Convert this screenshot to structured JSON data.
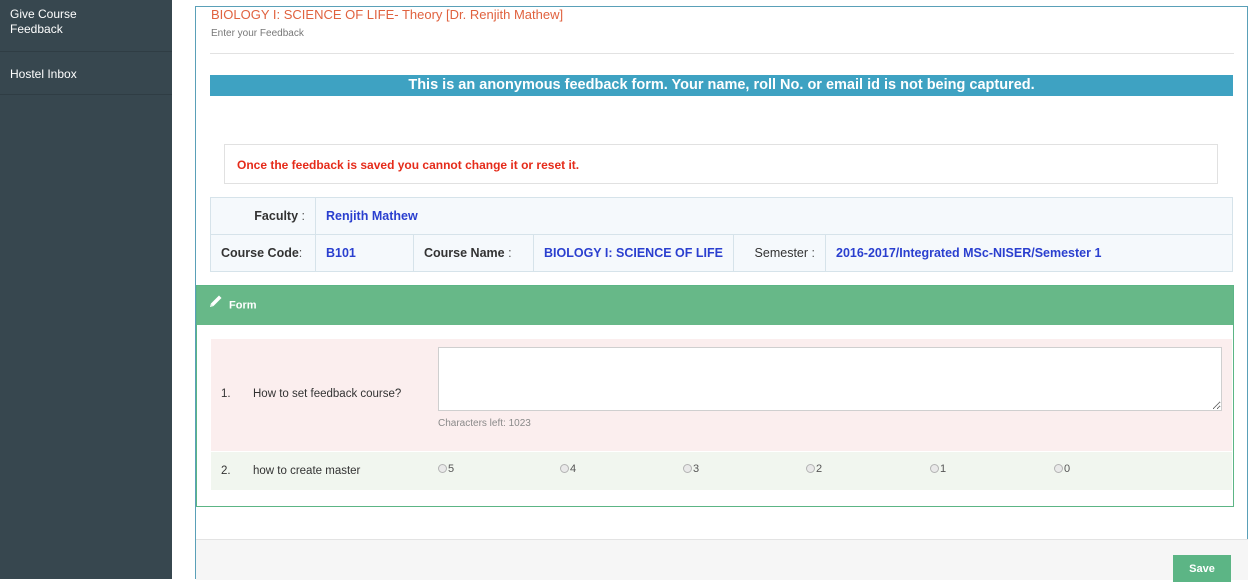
{
  "sidebar": {
    "items": [
      {
        "label": "Give Course Feedback"
      },
      {
        "label": "Hostel Inbox"
      }
    ]
  },
  "header": {
    "title": "BIOLOGY I: SCIENCE OF LIFE- Theory [Dr. Renjith Mathew]",
    "subtitle": "Enter your Feedback"
  },
  "banner": "This is an anonymous feedback form. Your name, roll No. or email id is not being captured.",
  "warning": "Once the feedback is saved you cannot change it or reset it.",
  "info": {
    "faculty_label": "Faculty",
    "faculty_value": "Renjith Mathew",
    "course_code_label": "Course Code",
    "course_code_value": "B101",
    "course_name_label": "Course Name",
    "course_name_value": "BIOLOGY I: SCIENCE OF LIFE",
    "semester_label": "Semester",
    "semester_value": "2016-2017/Integrated MSc-NISER/Semester 1"
  },
  "form": {
    "title": "Form",
    "questions": [
      {
        "num": "1.",
        "text": "How to set feedback course?",
        "chars_left": "Characters left: 1023",
        "value": ""
      },
      {
        "num": "2.",
        "text": "how to create master",
        "options": [
          "5",
          "4",
          "3",
          "2",
          "1",
          "0"
        ]
      }
    ]
  },
  "actions": {
    "save_label": "Save"
  },
  "colors": {
    "sidebar_bg": "#37474f",
    "title": "#e0623f",
    "banner_bg": "#3ea2c2",
    "warning": "#e52b1a",
    "value_text": "#2a3fcf",
    "form_header": "#67b888",
    "save_button": "#5cb585"
  },
  "icons": {
    "form_header": "pencil-icon"
  }
}
